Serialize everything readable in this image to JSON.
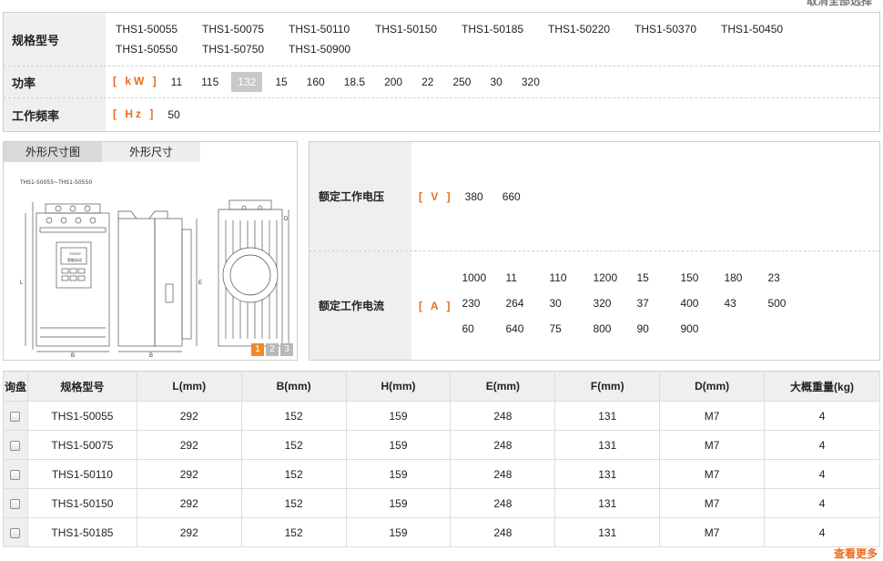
{
  "top_link": "取消全部选择",
  "filters": {
    "model": {
      "label": "规格型号",
      "options": [
        "THS1-50055",
        "THS1-50075",
        "THS1-50110",
        "THS1-50150",
        "THS1-50185",
        "THS1-50220",
        "THS1-50370",
        "THS1-50450",
        "THS1-50550",
        "THS1-50750",
        "THS1-50900"
      ]
    },
    "power": {
      "label": "功率",
      "unit": "[ kW ]",
      "options": [
        "11",
        "115",
        "132",
        "15",
        "160",
        "18.5",
        "200",
        "22",
        "250",
        "30",
        "320"
      ],
      "selected": "132"
    },
    "frequency": {
      "label": "工作频率",
      "unit": "[ Hz ]",
      "options": [
        "50"
      ]
    }
  },
  "image_panel": {
    "tabs": [
      "外形尺寸图",
      "外形尺寸"
    ],
    "drawing_caption": "THS1-50055~THS1-50550",
    "dim_labels": {
      "L": "L",
      "B": "B",
      "E": "E",
      "D": "D"
    },
    "panel_text": [
      "THS1P",
      "智能启动"
    ],
    "pages": [
      "1",
      "2",
      "3"
    ]
  },
  "voltage": {
    "label": "额定工作电压",
    "unit": "[ V ]",
    "options": [
      "380",
      "660"
    ]
  },
  "current": {
    "label": "额定工作电流",
    "unit": "[ A ]",
    "options": [
      "1000",
      "11",
      "110",
      "1200",
      "15",
      "150",
      "180",
      "23",
      "230",
      "264",
      "30",
      "320",
      "37",
      "400",
      "43",
      "500",
      "60",
      "640",
      "75",
      "800",
      "90",
      "900"
    ]
  },
  "table": {
    "headers": [
      "询盘",
      "规格型号",
      "L(mm)",
      "B(mm)",
      "H(mm)",
      "E(mm)",
      "F(mm)",
      "D(mm)",
      "大概重量(kg)"
    ],
    "rows": [
      [
        "THS1-50055",
        "292",
        "152",
        "159",
        "248",
        "131",
        "M7",
        "4"
      ],
      [
        "THS1-50075",
        "292",
        "152",
        "159",
        "248",
        "131",
        "M7",
        "4"
      ],
      [
        "THS1-50110",
        "292",
        "152",
        "159",
        "248",
        "131",
        "M7",
        "4"
      ],
      [
        "THS1-50150",
        "292",
        "152",
        "159",
        "248",
        "131",
        "M7",
        "4"
      ],
      [
        "THS1-50185",
        "292",
        "152",
        "159",
        "248",
        "131",
        "M7",
        "4"
      ]
    ]
  },
  "more_link": "查看更多",
  "colors": {
    "accent": "#e86d1b",
    "header_bg": "#efefef",
    "border": "#cfcfcf",
    "page_active": "#f08a24"
  }
}
